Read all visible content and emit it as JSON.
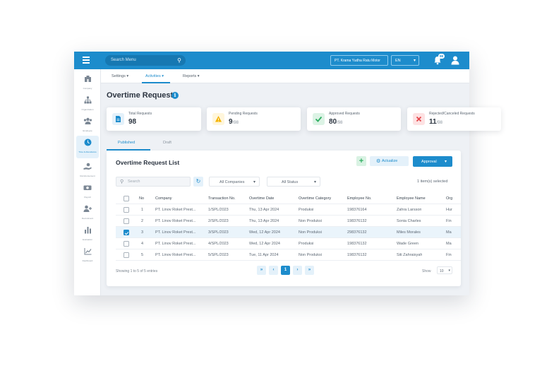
{
  "topbar": {
    "search_placeholder": "Search Menu",
    "company": "PT. Krama Yudha Ratu Motor",
    "language": "EN",
    "notification_count": "98"
  },
  "sidebar": {
    "items": [
      {
        "label": "Company",
        "icon": "building-icon"
      },
      {
        "label": "Organization",
        "icon": "org-chart-icon"
      },
      {
        "label": "Employee",
        "icon": "users-icon"
      },
      {
        "label": "Time & Attendance",
        "icon": "clock-icon"
      },
      {
        "label": "Reimbursement",
        "icon": "hand-money-icon"
      },
      {
        "label": "Payroll",
        "icon": "money-icon"
      },
      {
        "label": "Recruitment",
        "icon": "user-plus-icon"
      },
      {
        "label": "Evaluation",
        "icon": "bar-chart-icon"
      },
      {
        "label": "Dashboard",
        "icon": "line-chart-icon"
      }
    ]
  },
  "subnav": {
    "settings": "Settings",
    "activities": "Activities",
    "reports": "Reports"
  },
  "page": {
    "title": "Overtime Request"
  },
  "cards": [
    {
      "title": "Total Requests",
      "value": "98",
      "suffix": "",
      "color": "#1d8ccc"
    },
    {
      "title": "Pending Requests",
      "value": "9",
      "suffix": "/98",
      "color": "#f5b400"
    },
    {
      "title": "Approved Requests",
      "value": "80",
      "suffix": "/98",
      "color": "#2fae61"
    },
    {
      "title": "Rejected/Canceled Requests",
      "value": "11",
      "suffix": "/98",
      "color": "#e5484d"
    }
  ],
  "tabs": {
    "published": "Published",
    "draft": "Draft"
  },
  "list": {
    "title": "Overtime Request List",
    "actualize": "Actualize",
    "approval": "Approval",
    "search_placeholder": "Search",
    "filter_company": "All Companies",
    "filter_status": "All Status",
    "selected_count": "1 item(s) selected",
    "columns": [
      "No",
      "Company",
      "Transaction No.",
      "Overtime Date",
      "Overtime Category",
      "Employee No.",
      "Employee Name",
      "Org"
    ],
    "rows": [
      {
        "no": "1",
        "company": "PT. Linov Roket Prest...",
        "trx": "1/SPL/2023",
        "date": "Thu, 13 Apr 2024",
        "category": "Produksi",
        "emp_no": "198376164",
        "emp_name": "Zahra Larsson",
        "org": "Hur",
        "checked": false
      },
      {
        "no": "2",
        "company": "PT. Linov Roket Prest...",
        "trx": "2/SPL/2023",
        "date": "Thu, 13 Apr 2024",
        "category": "Non Produksi",
        "emp_no": "198376132",
        "emp_name": "Sonia Charles",
        "org": "Fin",
        "checked": false
      },
      {
        "no": "3",
        "company": "PT. Linov Roket Prest...",
        "trx": "3/SPL/2023",
        "date": "Wed, 12 Apr 2024",
        "category": "Non Produksi",
        "emp_no": "298376132",
        "emp_name": "Miles Morales",
        "org": "Ma",
        "checked": true
      },
      {
        "no": "4",
        "company": "PT. Linov Roket Prest...",
        "trx": "4/SPL/2023",
        "date": "Wed, 12 Apr 2024",
        "category": "Produksi",
        "emp_no": "198376132",
        "emp_name": "Wade Green",
        "org": "Ma",
        "checked": false
      },
      {
        "no": "5",
        "company": "PT. Linov Roket Prest...",
        "trx": "5/SPL/2023",
        "date": "Tue, 11 Apr 2024",
        "category": "Non Produksi",
        "emp_no": "198376132",
        "emp_name": "Siti Zahraisyah",
        "org": "Fin",
        "checked": false
      }
    ],
    "showing": "Showing 1 to 5 of 5 entries",
    "current_page": "1",
    "show_label": "Show",
    "page_size": "10"
  }
}
